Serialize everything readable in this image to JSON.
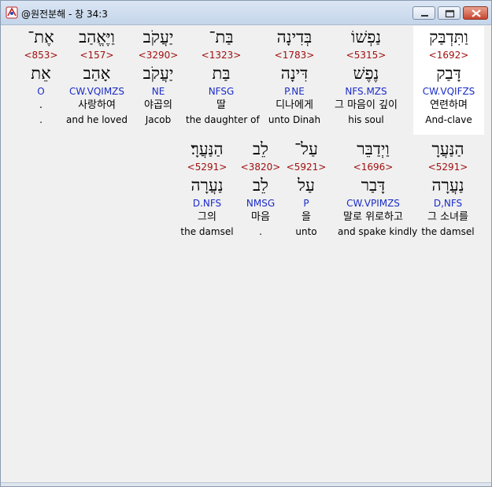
{
  "window": {
    "title": "@원전분해 - 창 34:3"
  },
  "words": [
    {
      "hebrew": "וַתִּדְבַּק",
      "strong": "<1692>",
      "lemma": "דָּבַק",
      "morph": "CW.VQIFZS",
      "korean": "연련하며",
      "english": "And-clave",
      "selected": true
    },
    {
      "hebrew": "נַפְשׁוֹ",
      "strong": "<5315>",
      "lemma": "נֶפֶשׁ",
      "morph": "NFS.MZS",
      "korean": "그 마음이 깊이",
      "english": "his soul",
      "selected": false
    },
    {
      "hebrew": "בְּדִינָה",
      "strong": "<1783>",
      "lemma": "דִּינָה",
      "morph": "P.NE",
      "korean": "디나에게",
      "english": "unto Dinah",
      "selected": false
    },
    {
      "hebrew": "בַּת־",
      "strong": "<1323>",
      "lemma": "בַּת",
      "morph": "NFSG",
      "korean": "딸",
      "english": "the daughter of",
      "selected": false
    },
    {
      "hebrew": "יַעֲקֹב",
      "strong": "<3290>",
      "lemma": "יַעֲקֹב",
      "morph": "NE",
      "korean": "야곱의",
      "english": "Jacob",
      "selected": false
    },
    {
      "hebrew": "וַיֶּאֱהַב",
      "strong": "<157>",
      "lemma": "אָהַב",
      "morph": "CW.VQIMZS",
      "korean": "사랑하여",
      "english": "and he loved",
      "selected": false
    },
    {
      "hebrew": "אֶת־",
      "strong": "<853>",
      "lemma": "אֵת",
      "morph": "O",
      "korean": ".",
      "english": ".",
      "selected": false
    },
    {
      "hebrew": "הַנַּעֲרָ",
      "strong": "<5291>",
      "lemma": "נַעֲרָה",
      "morph": "D,NFS",
      "korean": "그 소녀를",
      "english": "the damsel",
      "selected": false
    },
    {
      "hebrew": "וַיְדַבֵּר",
      "strong": "<1696>",
      "lemma": "דָּבַר",
      "morph": "CW.VPIMZS",
      "korean": "말로 위로하고",
      "english": "and spake kindly",
      "selected": false
    },
    {
      "hebrew": "עַל־",
      "strong": "<5921>",
      "lemma": "עַל",
      "morph": "P",
      "korean": "을",
      "english": "unto",
      "selected": false
    },
    {
      "hebrew": "לֵב",
      "strong": "<3820>",
      "lemma": "לֵב",
      "morph": "NMSG",
      "korean": "마음",
      "english": ".",
      "selected": false
    },
    {
      "hebrew": "הַנַּעֲרָ׃",
      "strong": "<5291>",
      "lemma": "נַעֲרָה",
      "morph": "D.NFS",
      "korean": "그의",
      "english": "the damsel",
      "selected": false
    }
  ]
}
